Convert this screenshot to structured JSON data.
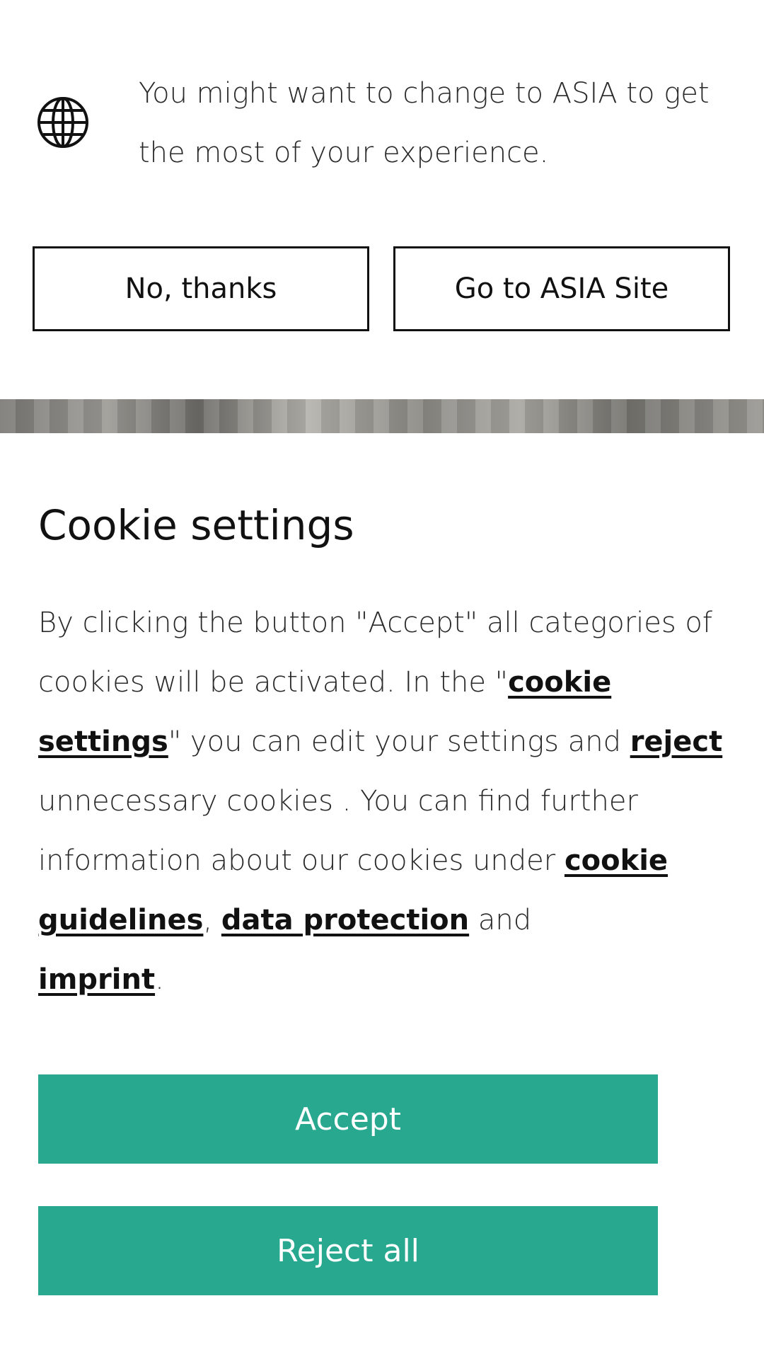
{
  "region_banner": {
    "icon": "globe-icon",
    "message": "You might want to change to ASIA to get the most of your experience.",
    "no_thanks_label": "No, thanks",
    "go_to_site_label": "Go to ASIA Site"
  },
  "cookie": {
    "title": "Cookie settings",
    "text_1": "By clicking the button \"Accept\" all categories of cookies will be activated. In the \"",
    "link_cookie_settings": "cookie settings",
    "text_2": "\" you can edit your settings and ",
    "link_reject": "reject",
    "text_3": " unnecessary cookies . You can find further information about our cookies under ",
    "link_cookie_guidelines": "cookie guidelines",
    "text_4": ", ",
    "link_data_protection": "data protection",
    "text_5": " and ",
    "link_imprint": "imprint",
    "text_6": ".",
    "accept_label": "Accept",
    "reject_all_label": "Reject all"
  },
  "colors": {
    "accent_green": "#27a88f",
    "text": "#1a1a1a",
    "background": "#ffffff"
  }
}
